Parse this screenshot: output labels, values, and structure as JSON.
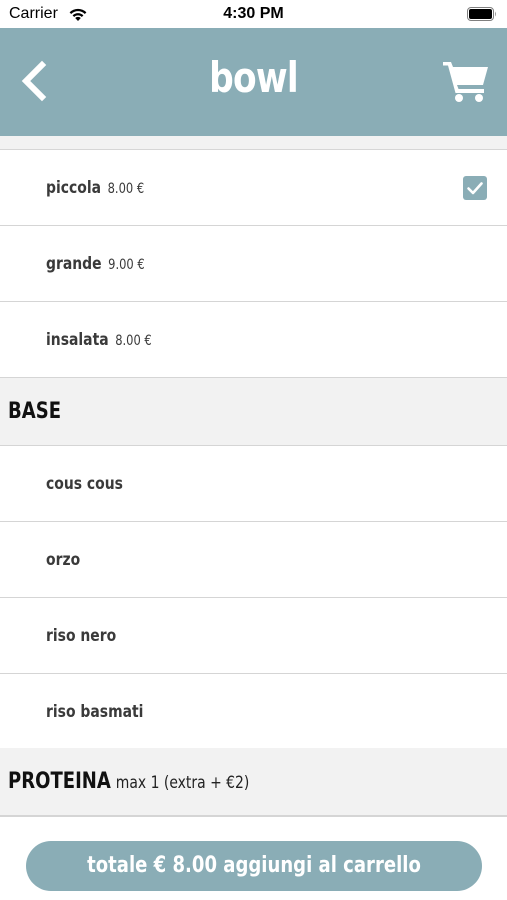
{
  "status_bar": {
    "carrier": "Carrier",
    "time": "4:30 PM"
  },
  "nav": {
    "title": "bowl",
    "back_icon": "chevron-left-icon",
    "cart_icon": "shopping-cart-icon",
    "background": "#8aadb6"
  },
  "sizes": [
    {
      "name": "piccola",
      "price": "8.00 €",
      "selected": true
    },
    {
      "name": "grande",
      "price": "9.00 €",
      "selected": false
    },
    {
      "name": "insalata",
      "price": "8.00 €",
      "selected": false
    }
  ],
  "base_section": {
    "title": "BASE",
    "items": [
      {
        "name": "cous cous"
      },
      {
        "name": "orzo"
      },
      {
        "name": "riso nero"
      },
      {
        "name": "riso basmati"
      }
    ]
  },
  "protein_section": {
    "title": "PROTEINA",
    "note": "max 1 (extra + €2)"
  },
  "footer": {
    "button_label": "totale € 8.00 aggiungi al carrello"
  },
  "colors": {
    "accent": "#8aadb6",
    "section_bg": "#f2f2f2",
    "separator": "#d5d5d5"
  }
}
